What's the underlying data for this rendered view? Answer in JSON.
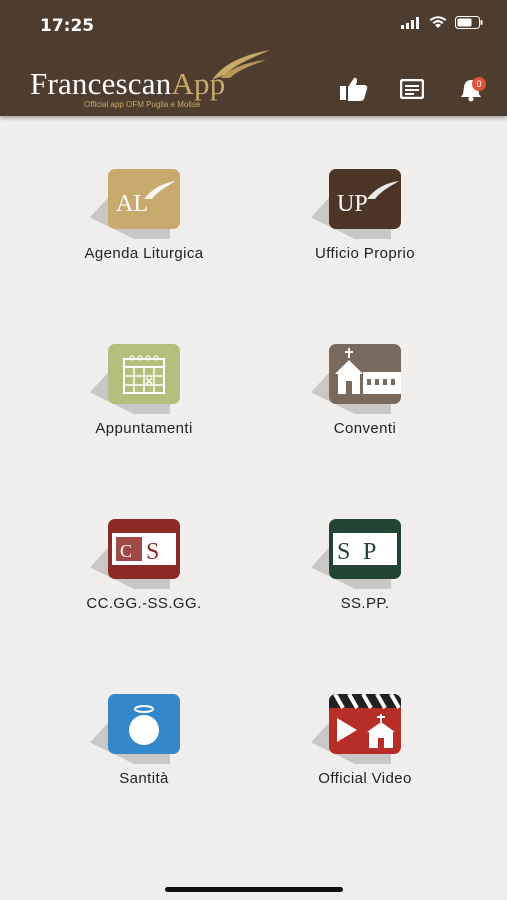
{
  "status_bar": {
    "time": "17:25"
  },
  "header": {
    "logo_main_1": "Francescan",
    "logo_main_2": "App",
    "logo_sub": "Official app OFM Puglia e Molise",
    "notification_count": "0"
  },
  "tiles": [
    {
      "label": "Agenda Liturgica",
      "icon": "AL",
      "color": "#c8a96e"
    },
    {
      "label": "Ufficio Proprio",
      "icon": "UP",
      "color": "#4b3526"
    },
    {
      "label": "Appuntamenti",
      "icon": "calendar-icon",
      "color": "#b3c07b"
    },
    {
      "label": "Conventi",
      "icon": "church-icon",
      "color": "#7a6a5e"
    },
    {
      "label": "CC.GG.-SS.GG.",
      "icon": "CS",
      "color": "#8e2a25"
    },
    {
      "label": "SS.PP.",
      "icon": "SP",
      "color": "#214535"
    },
    {
      "label": "Santità",
      "icon": "halo-icon",
      "color": "#3388cc"
    },
    {
      "label": "Official Video",
      "icon": "video-icon",
      "color": "#b72d27"
    }
  ]
}
